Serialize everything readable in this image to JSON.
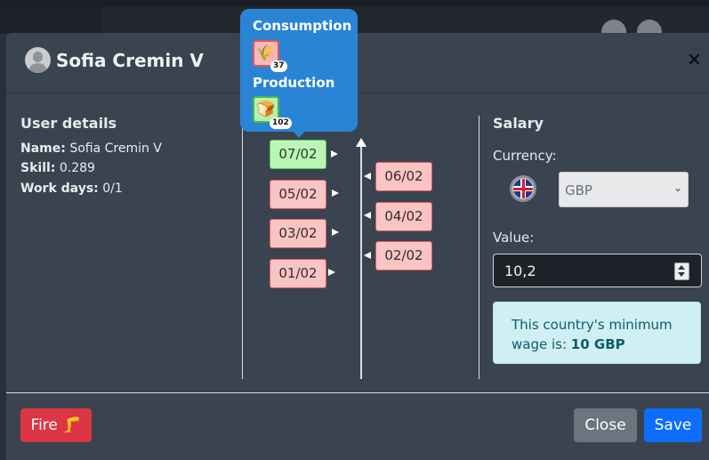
{
  "modal": {
    "title": "Sofia Cremin V",
    "close_icon": "×"
  },
  "user_details": {
    "heading": "User details",
    "name_label": "Name:",
    "name_value": "Sofia Cremin V",
    "skill_label": "Skill:",
    "skill_value": "0.289",
    "workdays_label": "Work days:",
    "workdays_value": "0/1"
  },
  "timeline": {
    "left_dates": [
      "07/02",
      "05/02",
      "03/02",
      "01/02"
    ],
    "right_dates": [
      "06/02",
      "04/02",
      "02/02"
    ],
    "current": "07/02"
  },
  "popover": {
    "consumption_label": "Consumption",
    "consumption_icon": "grain-icon",
    "consumption_count": "37",
    "production_label": "Production",
    "production_icon": "bread-icon",
    "production_count": "102"
  },
  "salary": {
    "heading": "Salary",
    "currency_label": "Currency:",
    "currency_flag": "uk-flag-icon",
    "currency_selected": "GBP",
    "value_label": "Value:",
    "value": "10,2",
    "info_prefix": "This country's minimum wage is:",
    "info_amount": "10 GBP"
  },
  "footer": {
    "fire_label": "Fire 🦵",
    "close_label": "Close",
    "save_label": "Save"
  },
  "colors": {
    "fire": "#dc3545",
    "close": "#6c757d",
    "save": "#0d6efd",
    "popover": "#2a84d6"
  }
}
